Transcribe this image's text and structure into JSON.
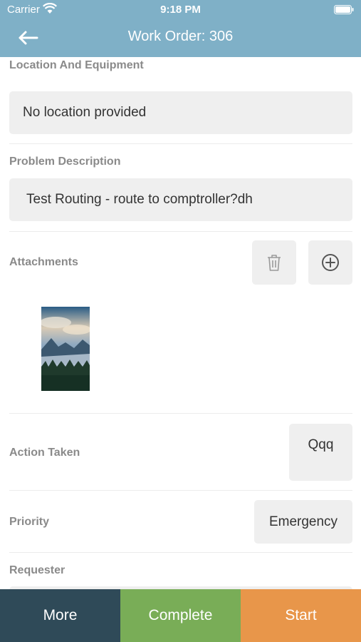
{
  "status_bar": {
    "carrier": "Carrier",
    "time": "9:18 PM"
  },
  "header": {
    "title": "Work Order: 306",
    "back_icon": "arrow-left-icon"
  },
  "sections": {
    "location": {
      "label": "Location And Equipment",
      "value": "No location provided"
    },
    "problem": {
      "label": "Problem Description",
      "value": "Test Routing - route to comptroller?dh"
    },
    "attachments": {
      "label": "Attachments",
      "delete_icon": "trash-icon",
      "add_icon": "plus-circle-icon"
    },
    "action_taken": {
      "label": "Action Taken",
      "value": "Qqq"
    },
    "priority": {
      "label": "Priority",
      "value": "Emergency"
    },
    "requester": {
      "label": "Requester"
    }
  },
  "bottom_bar": {
    "more": "More",
    "complete": "Complete",
    "start": "Start"
  },
  "colors": {
    "header": "#7fb0c7",
    "more": "#2f4a58",
    "complete": "#79ad57",
    "start": "#e8964a"
  }
}
